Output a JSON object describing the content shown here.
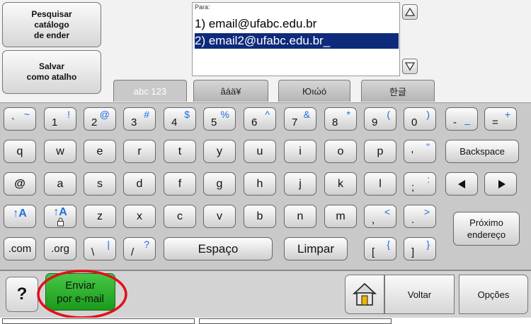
{
  "left_buttons": {
    "search_address_book": "Pesquisar\ncatálogo\nde ender",
    "save_shortcut": "Salvar\ncomo atalho"
  },
  "recipients": {
    "field_label": "Para:",
    "items": [
      "1)  email@ufabc.edu.br",
      "2)  email2@ufabc.edu.br_"
    ],
    "selected_index": 1
  },
  "layout_tabs": [
    {
      "label": "abc 123",
      "active": true
    },
    {
      "label": "âáä¥",
      "active": false
    },
    {
      "label": "Юıώó",
      "active": false
    },
    {
      "label": "한글",
      "active": false
    }
  ],
  "keys": {
    "row1": [
      {
        "main": "`",
        "shift": "~"
      },
      {
        "main": "1",
        "shift": "!"
      },
      {
        "main": "2",
        "shift": "@"
      },
      {
        "main": "3",
        "shift": "#"
      },
      {
        "main": "4",
        "shift": "$"
      },
      {
        "main": "5",
        "shift": "%"
      },
      {
        "main": "6",
        "shift": "^"
      },
      {
        "main": "7",
        "shift": "&"
      },
      {
        "main": "8",
        "shift": "*"
      },
      {
        "main": "9",
        "shift": "("
      },
      {
        "main": "0",
        "shift": ")"
      },
      {
        "main": "-",
        "shift": "_"
      },
      {
        "main": "=",
        "shift": "+"
      }
    ],
    "row2": [
      "q",
      "w",
      "e",
      "r",
      "t",
      "y",
      "u",
      "i",
      "o",
      "p"
    ],
    "row2_extra": {
      "main": "'",
      "shift": "\""
    },
    "backspace": "Backspace",
    "row3_at": "@",
    "row3": [
      "a",
      "s",
      "d",
      "f",
      "g",
      "h",
      "j",
      "k",
      "l"
    ],
    "row3_extra": {
      "main": ";",
      "shift": ":"
    },
    "row4_shift": "↑A",
    "row4_capslock": "↑A",
    "row4": [
      "z",
      "x",
      "c",
      "v",
      "b",
      "n",
      "m"
    ],
    "row4_extra": [
      {
        "main": ",",
        "shift": "<"
      },
      {
        "main": ".",
        "shift": ">"
      }
    ],
    "next_address": "Próximo\nendereço",
    "row5_com": ".com",
    "row5_org": ".org",
    "row5_backslash": {
      "main": "\\",
      "shift": "|"
    },
    "row5_slash": {
      "main": "/",
      "shift": "?"
    },
    "space": "Espaço",
    "clear": "Limpar",
    "row5_brackets": [
      {
        "main": "[",
        "shift": "{"
      },
      {
        "main": "]",
        "shift": "}"
      }
    ]
  },
  "bottom": {
    "help": "?",
    "send_email": "Enviar\npor e-mail",
    "back": "Voltar",
    "options": "Opções"
  },
  "colors": {
    "send_green": "#22aa22",
    "highlight_circle": "#e0101a",
    "selection": "#0e2a7a",
    "tab_active_text": "#ffffff",
    "shift_symbol": "#1d6fe0"
  }
}
